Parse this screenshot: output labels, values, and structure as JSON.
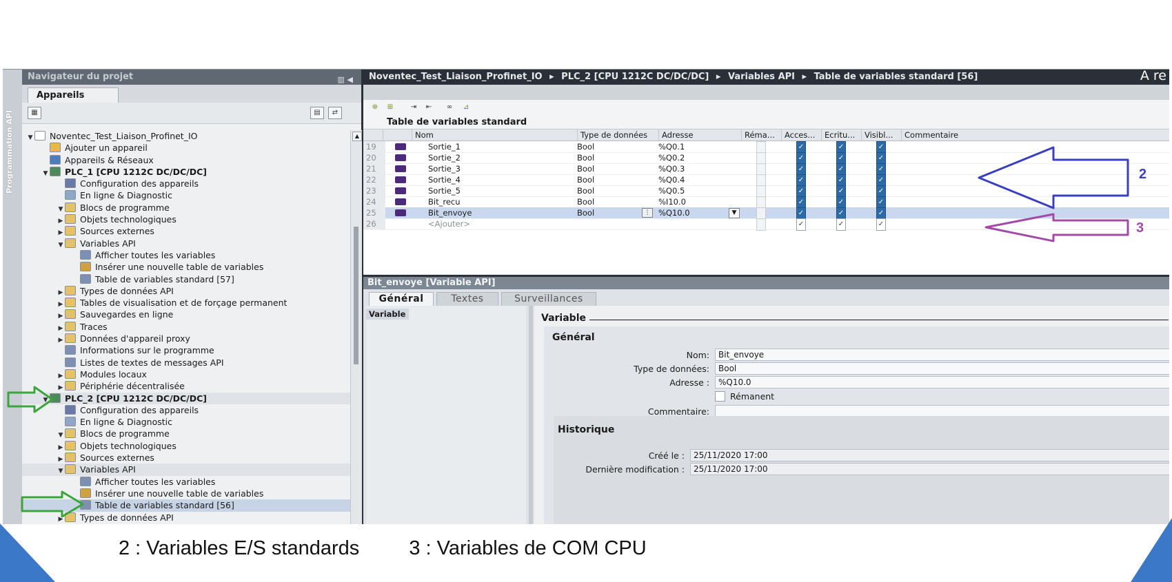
{
  "vertical_tab": "Programmation API",
  "navigator": {
    "title": "Navigateur du projet",
    "tab": "Appareils",
    "tree": [
      {
        "label": "Noventec_Test_Liaison_Profinet_IO",
        "indent": 0,
        "toggle": "▼",
        "icon": "#ffffff"
      },
      {
        "label": "Ajouter un appareil",
        "indent": 1,
        "toggle": "",
        "icon": "#e6b94a"
      },
      {
        "label": "Appareils & Réseaux",
        "indent": 1,
        "toggle": "",
        "icon": "#4f7cba"
      },
      {
        "label": "PLC_1 [CPU 1212C DC/DC/DC]",
        "indent": 1,
        "toggle": "▼",
        "icon": "#4d8a5a",
        "bold": true
      },
      {
        "label": "Configuration des appareils",
        "indent": 2,
        "toggle": "",
        "icon": "#6a7aa8"
      },
      {
        "label": "En ligne & Diagnostic",
        "indent": 2,
        "toggle": "",
        "icon": "#8ea7c9"
      },
      {
        "label": "Blocs de programme",
        "indent": 2,
        "toggle": "▼",
        "icon": "#e3c26a"
      },
      {
        "label": "Objets technologiques",
        "indent": 2,
        "toggle": "▶",
        "icon": "#e3c26a"
      },
      {
        "label": "Sources externes",
        "indent": 2,
        "toggle": "▶",
        "icon": "#e3c26a"
      },
      {
        "label": "Variables API",
        "indent": 2,
        "toggle": "▼",
        "icon": "#e3c26a"
      },
      {
        "label": "Afficher toutes les variables",
        "indent": 3,
        "toggle": "",
        "icon": "#7d8fb3"
      },
      {
        "label": "Insérer une nouvelle table de variables",
        "indent": 3,
        "toggle": "",
        "icon": "#d0a23f"
      },
      {
        "label": "Table de variables standard [57]",
        "indent": 3,
        "toggle": "",
        "icon": "#7d8fb3"
      },
      {
        "label": "Types de données API",
        "indent": 2,
        "toggle": "▶",
        "icon": "#e3c26a"
      },
      {
        "label": "Tables de visualisation et de forçage permanent",
        "indent": 2,
        "toggle": "▶",
        "icon": "#e3c26a"
      },
      {
        "label": "Sauvegardes en ligne",
        "indent": 2,
        "toggle": "▶",
        "icon": "#e3c26a"
      },
      {
        "label": "Traces",
        "indent": 2,
        "toggle": "▶",
        "icon": "#e3c26a"
      },
      {
        "label": "Données d'appareil proxy",
        "indent": 2,
        "toggle": "▶",
        "icon": "#e3c26a"
      },
      {
        "label": "Informations sur le programme",
        "indent": 2,
        "toggle": "",
        "icon": "#7d8fb3"
      },
      {
        "label": "Listes de textes de messages API",
        "indent": 2,
        "toggle": "",
        "icon": "#7d8fb3"
      },
      {
        "label": "Modules locaux",
        "indent": 2,
        "toggle": "▶",
        "icon": "#e3c26a"
      },
      {
        "label": "Périphérie décentralisée",
        "indent": 2,
        "toggle": "▶",
        "icon": "#e3c26a"
      },
      {
        "label": "PLC_2 [CPU 1212C DC/DC/DC]",
        "indent": 1,
        "toggle": "▼",
        "icon": "#4d8a5a",
        "bold": true,
        "hl": true
      },
      {
        "label": "Configuration des appareils",
        "indent": 2,
        "toggle": "",
        "icon": "#6a7aa8"
      },
      {
        "label": "En ligne & Diagnostic",
        "indent": 2,
        "toggle": "",
        "icon": "#8ea7c9"
      },
      {
        "label": "Blocs de programme",
        "indent": 2,
        "toggle": "▼",
        "icon": "#e3c26a"
      },
      {
        "label": "Objets technologiques",
        "indent": 2,
        "toggle": "▶",
        "icon": "#e3c26a"
      },
      {
        "label": "Sources externes",
        "indent": 2,
        "toggle": "▶",
        "icon": "#e3c26a"
      },
      {
        "label": "Variables API",
        "indent": 2,
        "toggle": "▼",
        "icon": "#e3c26a",
        "hl": true
      },
      {
        "label": "Afficher toutes les variables",
        "indent": 3,
        "toggle": "",
        "icon": "#7d8fb3"
      },
      {
        "label": "Insérer une nouvelle table de variables",
        "indent": 3,
        "toggle": "",
        "icon": "#d0a23f"
      },
      {
        "label": "Table de variables standard [56]",
        "indent": 3,
        "toggle": "",
        "icon": "#7d8fb3",
        "sel": true
      },
      {
        "label": "Types de données API",
        "indent": 2,
        "toggle": "▶",
        "icon": "#e3c26a"
      }
    ]
  },
  "breadcrumb": {
    "parts": [
      "Noventec_Test_Liaison_Profinet_IO",
      "PLC_2 [CPU 1212C DC/DC/DC]",
      "Variables API",
      "Table de variables standard [56]"
    ],
    "separator": "▸",
    "cut_text": "A re"
  },
  "table": {
    "title": "Table de variables standard",
    "columns": [
      "Nom",
      "Type de données",
      "Adresse",
      "Réma...",
      "Acces...",
      "Ecritu...",
      "Visibl...",
      "Commentaire"
    ],
    "rows": [
      {
        "num": "19",
        "name": "Sortie_1",
        "type": "Bool",
        "address": "%Q0.1",
        "rema": false,
        "acc": true,
        "ecr": true,
        "vis": true
      },
      {
        "num": "20",
        "name": "Sortie_2",
        "type": "Bool",
        "address": "%Q0.2",
        "rema": false,
        "acc": true,
        "ecr": true,
        "vis": true
      },
      {
        "num": "21",
        "name": "Sortie_3",
        "type": "Bool",
        "address": "%Q0.3",
        "rema": false,
        "acc": true,
        "ecr": true,
        "vis": true
      },
      {
        "num": "22",
        "name": "Sortie_4",
        "type": "Bool",
        "address": "%Q0.4",
        "rema": false,
        "acc": true,
        "ecr": true,
        "vis": true
      },
      {
        "num": "23",
        "name": "Sortie_5",
        "type": "Bool",
        "address": "%Q0.5",
        "rema": false,
        "acc": true,
        "ecr": true,
        "vis": true
      },
      {
        "num": "24",
        "name": "Bit_recu",
        "type": "Bool",
        "address": "%I10.0",
        "rema": false,
        "acc": true,
        "ecr": true,
        "vis": true
      },
      {
        "num": "25",
        "name": "Bit_envoye",
        "type": "Bool",
        "address": "%Q10.0",
        "rema": false,
        "acc": true,
        "ecr": true,
        "vis": true,
        "selected": true
      },
      {
        "num": "26",
        "name": "<Ajouter>",
        "type": "",
        "address": "",
        "rema": false,
        "acc": true,
        "ecr": true,
        "vis": true,
        "add": true
      }
    ]
  },
  "properties": {
    "title": "Bit_envoye [Variable API]",
    "tabs": [
      "Général",
      "Textes",
      "Surveillances"
    ],
    "left_item": "Variable",
    "section": "Variable",
    "group": "Général",
    "fields": {
      "name_label": "Nom:",
      "name_value": "Bit_envoye",
      "type_label": "Type de données:",
      "type_value": "Bool",
      "address_label": "Adresse :",
      "address_value": "%Q10.0",
      "remanent_label": "Rémanent",
      "comment_label": "Commentaire:",
      "comment_value": ""
    },
    "history": {
      "title": "Historique",
      "created_label": "Créé le :",
      "created_value": "25/11/2020 17:00",
      "modified_label": "Dernière modification :",
      "modified_value": "25/11/2020 17:00"
    }
  },
  "annotations": {
    "label_2": "2",
    "label_3": "3",
    "color_2": "#3a3fc0",
    "color_3": "#a24aa8",
    "color_green": "#3aa63a"
  },
  "caption": {
    "item_2": "2  : Variables E/S standards",
    "item_3": "3 : Variables de COM CPU"
  }
}
